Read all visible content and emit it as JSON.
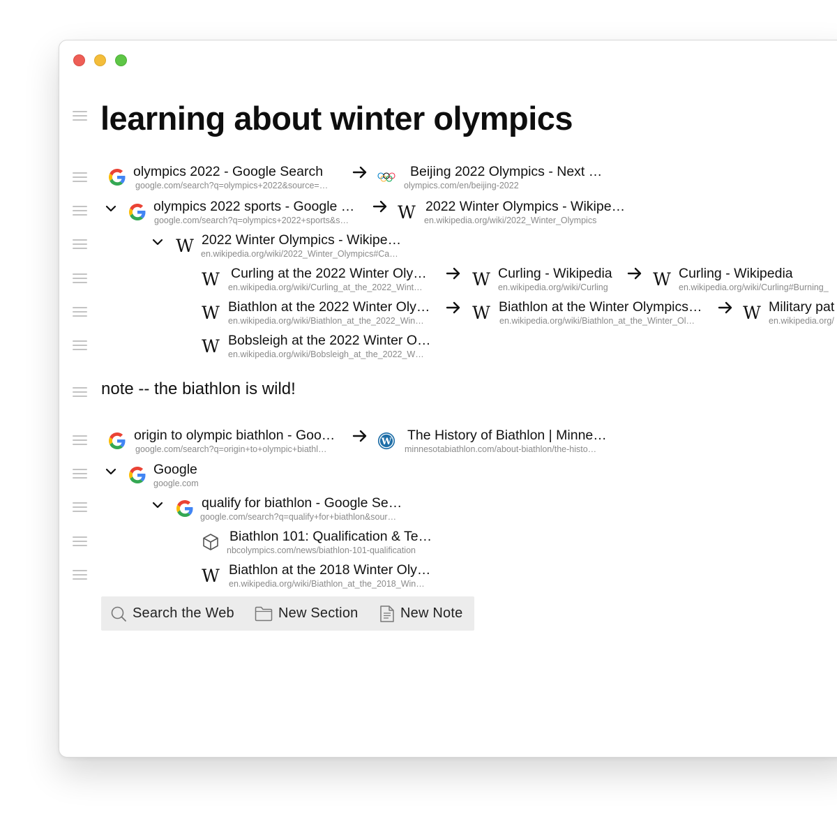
{
  "page_title": "learning about winter olympics",
  "note_text": "note -- the biathlon is wild!",
  "tabs": {
    "g_olympics": {
      "title": "olympics 2022 - Google Search",
      "url": "google.com/search?q=olympics+2022&source=…"
    },
    "beijing": {
      "title": "Beijing 2022 Olympics - Next …",
      "url": "olympics.com/en/beijing-2022"
    },
    "g_sports": {
      "title": "olympics 2022 sports - Google …",
      "url": "google.com/search?q=olympics+2022+sports&s…"
    },
    "wiki_winter": {
      "title": "2022 Winter Olympics - Wikipe…",
      "url": "en.wikipedia.org/wiki/2022_Winter_Olympics"
    },
    "wiki_winter_ca": {
      "title": "2022 Winter Olympics - Wikipe…",
      "url": "en.wikipedia.org/wiki/2022_Winter_Olympics#Ca…"
    },
    "curling_2022": {
      "title": "Curling at the 2022 Winter Oly…",
      "url": "en.wikipedia.org/wiki/Curling_at_the_2022_Wint…"
    },
    "curling_wiki": {
      "title": "Curling - Wikipedia",
      "url": "en.wikipedia.org/wiki/Curling"
    },
    "curling_burning": {
      "title": "Curling - Wikipedia",
      "url": "en.wikipedia.org/wiki/Curling#Burning_"
    },
    "biathlon_2022": {
      "title": "Biathlon at the 2022 Winter Oly…",
      "url": "en.wikipedia.org/wiki/Biathlon_at_the_2022_Win…"
    },
    "biathlon_winter": {
      "title": "Biathlon at the Winter Olympics…",
      "url": "en.wikipedia.org/wiki/Biathlon_at_the_Winter_Ol…"
    },
    "military": {
      "title": "Military pat",
      "url": "en.wikipedia.org/"
    },
    "bobsleigh": {
      "title": "Bobsleigh at the 2022 Winter O…",
      "url": "en.wikipedia.org/wiki/Bobsleigh_at_the_2022_W…"
    },
    "g_origin": {
      "title": "origin to olympic biathlon - Goo…",
      "url": "google.com/search?q=origin+to+olympic+biathl…"
    },
    "history": {
      "title": "The History of Biathlon | Minne…",
      "url": "minnesotabiathlon.com/about-biathlon/the-histo…"
    },
    "google": {
      "title": "Google",
      "url": "google.com"
    },
    "g_qualify": {
      "title": "qualify for biathlon - Google Se…",
      "url": "google.com/search?q=qualify+for+biathlon&sour…"
    },
    "biathlon101": {
      "title": "Biathlon 101: Qualification & Te…",
      "url": "nbcolympics.com/news/biathlon-101-qualification"
    },
    "biathlon_2018": {
      "title": "Biathlon at the 2018 Winter Oly…",
      "url": "en.wikipedia.org/wiki/Biathlon_at_the_2018_Win…"
    }
  },
  "toolbar": {
    "search_label": "Search the Web",
    "section_label": "New Section",
    "note_label": "New Note"
  },
  "icons": {
    "google": "google-icon",
    "wikipedia": "wikipedia-icon",
    "olympics": "olympic-rings-icon",
    "wordpress": "wordpress-icon",
    "box": "box-icon",
    "arrow": "arrow-right-icon",
    "chevron": "chevron-down-icon",
    "drag": "drag-handle-icon"
  },
  "colors": {
    "close": "#ee5e56",
    "minimize": "#f4bd3a",
    "maximize": "#5ec646",
    "toolbar_bg": "#ececec",
    "url_text": "#8a8a8a"
  }
}
